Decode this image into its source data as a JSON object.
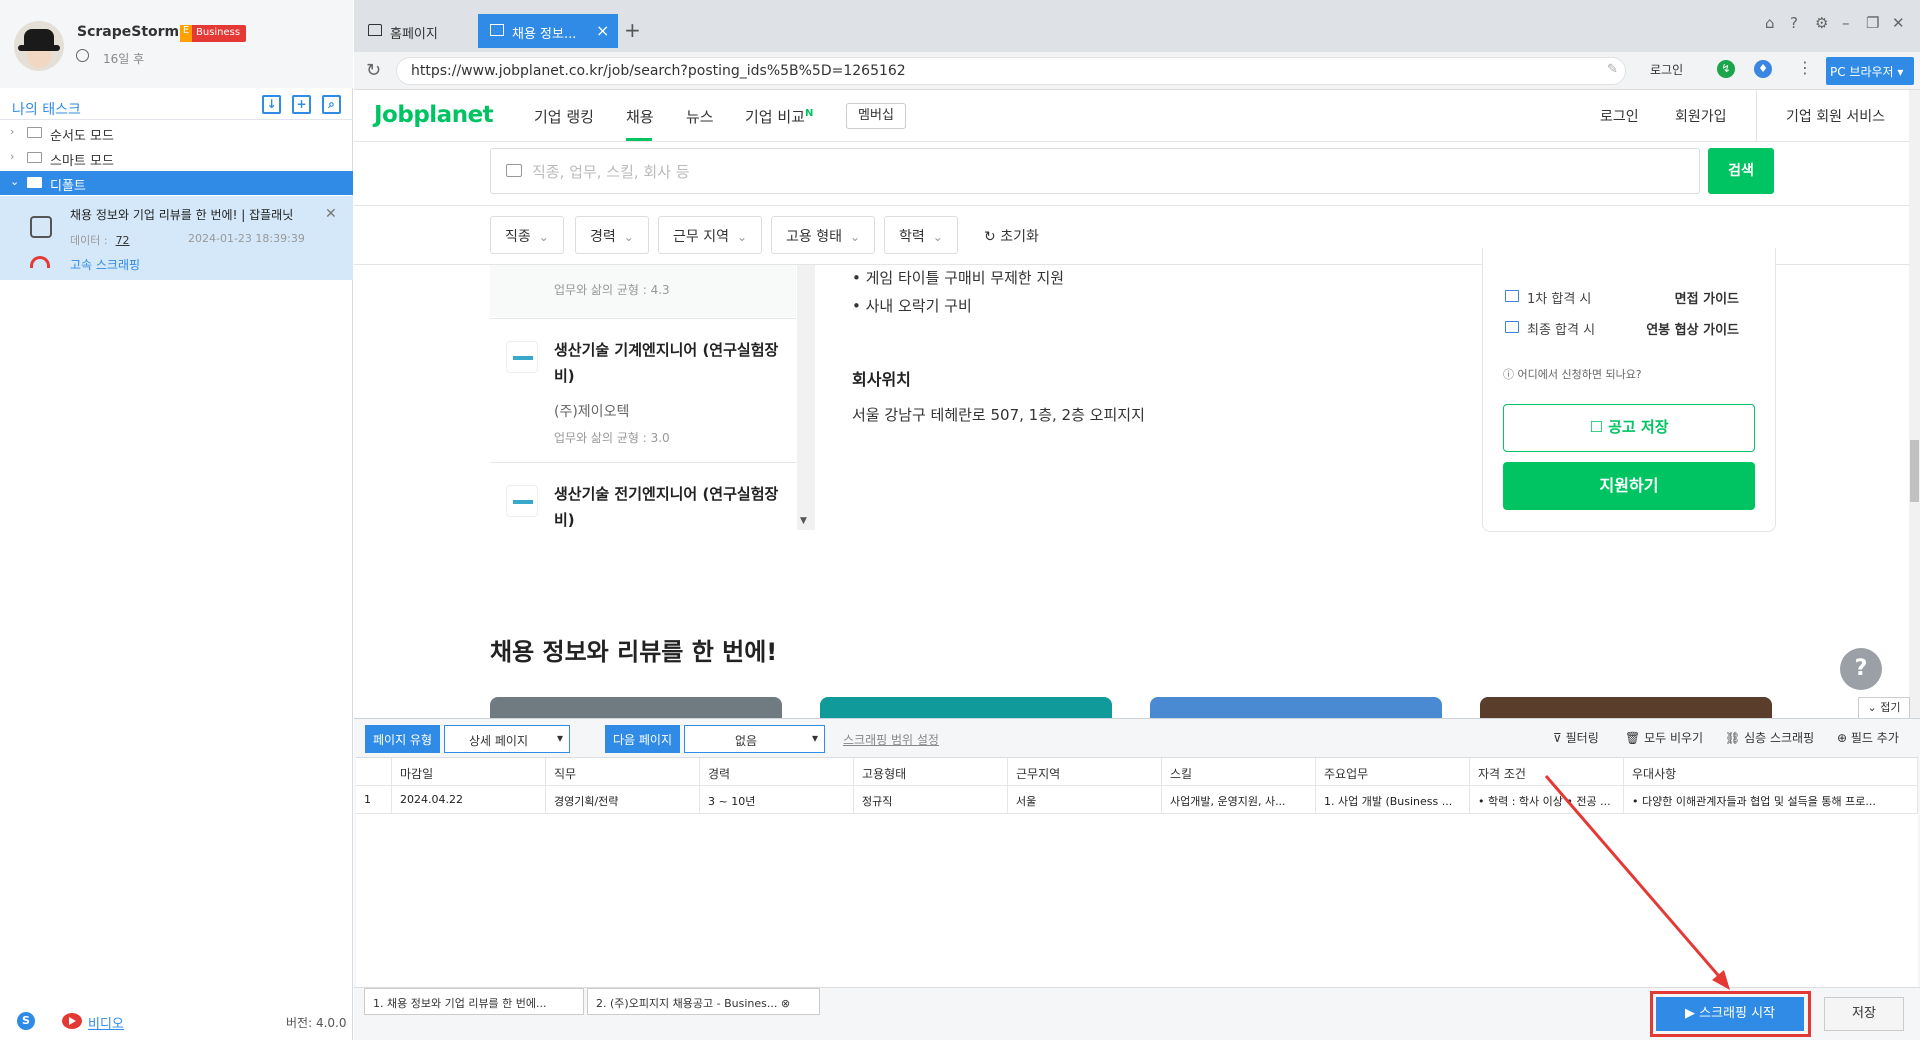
{
  "app": {
    "name": "ScrapeStorm",
    "badge": "Business",
    "days_left": "16일 후"
  },
  "sidebar": {
    "my_tasks": "나의 태스크",
    "tree": [
      {
        "label": "순서도 모드"
      },
      {
        "label": "스마트 모드"
      },
      {
        "label": "디폴트"
      }
    ],
    "task": {
      "title": "채용 정보와 기업 리뷰를 한 번에! | 잡플래닛",
      "data_label": "데이터 :",
      "data_count": "72",
      "date": "2024-01-23 18:39:39",
      "mode": "고속 스크래핑"
    },
    "footer": {
      "video": "비디오",
      "version": "버전: 4.0.0"
    }
  },
  "browser": {
    "tabs": [
      {
        "label": "홈페이지"
      },
      {
        "label": "채용 정보..."
      }
    ],
    "url": "https://www.jobplanet.co.kr/job/search?posting_ids%5B%5D=1265162",
    "login": "로그인",
    "pc_browser": "PC 브라우저"
  },
  "site": {
    "logo": "Jobplanet",
    "nav": [
      "기업 랭킹",
      "채용",
      "뉴스",
      "기업 비교"
    ],
    "nav_new": "N",
    "membership": "멤버십",
    "right_nav": [
      "로그인",
      "회원가입",
      "기업 회원 서비스"
    ],
    "search_placeholder": "직종, 업무, 스킬, 회사 등",
    "search_button": "검색",
    "filters": [
      "직종",
      "경력",
      "근무 지역",
      "고용 형태",
      "학력"
    ],
    "reset": "초기화",
    "list": [
      {
        "rating": "업무와 삶의 균형 : 4.3"
      },
      {
        "title": "생산기술 기계엔지니어 (연구실험장비)",
        "company": "(주)제이오텍",
        "rating": "업무와 삶의 균형 : 3.0"
      },
      {
        "title": "생산기술 전기엔지니어 (연구실험장비)"
      }
    ],
    "desc_lines": [
      "• 게임 타이틀 구매비 무제한 지원",
      "• 사내 오락기 구비"
    ],
    "location_title": "회사위치",
    "location": "서울 강남구 테헤란로 507, 1층, 2층 오피지지",
    "guides": [
      {
        "left": "1차 합격 시",
        "right": "면접 가이드"
      },
      {
        "left": "최종 합격 시",
        "right": "연봉 협상 가이드"
      }
    ],
    "where_apply": "어디에서 신청하면 되나요?",
    "save_posting": "공고 저장",
    "apply": "지원하기",
    "section_title": "채용 정보와 리뷰를 한 번에!",
    "help": "?",
    "fold": "접기"
  },
  "panel": {
    "page_type_label": "페이지 유형",
    "page_type_value": "상세 페이지",
    "next_page_label": "다음 페이지",
    "next_page_value": "없음",
    "range": "스크래핑 범위 설정",
    "tools": [
      "필터링",
      "모두 비우기",
      "심층 스크래핑",
      "필드 추가"
    ],
    "columns": [
      "마감일",
      "직무",
      "경력",
      "고용형태",
      "근무지역",
      "스킬",
      "주요업무",
      "자격 조건",
      "우대사항"
    ],
    "rows": [
      {
        "index": "1",
        "cells": [
          "2024.04.22",
          "경영기획/전략",
          "3 ~ 10년",
          "정규직",
          "서울",
          "사업개발, 운영지원, 사...",
          "1. 사업 개발 (Business ...",
          "• 학력 : 학사 이상 • 전공 ...",
          "• 다양한 이해관계자들과 협업 및 설득을 통해 프로..."
        ]
      }
    ],
    "bottom_tabs": [
      "1. 채용 정보와 기업 리뷰를 한 번에...",
      "2. (주)오피지지 채용공고 - Busines..."
    ],
    "start": "스크래핑 시작",
    "save": "저장"
  },
  "colors": {
    "accent": "#2f8be6",
    "jobplanet_green": "#00c362",
    "highlight": "#e53935"
  }
}
